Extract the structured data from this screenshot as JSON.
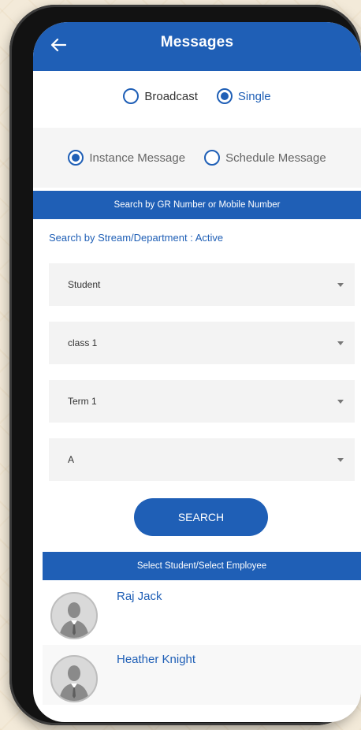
{
  "header": {
    "title": "Messages",
    "back_icon": "arrow-left-icon"
  },
  "recipient_mode": {
    "options": [
      {
        "label": "Broadcast",
        "selected": false
      },
      {
        "label": "Single",
        "selected": true
      }
    ]
  },
  "message_type": {
    "options": [
      {
        "label": "Instance Message",
        "selected": true
      },
      {
        "label": "Schedule Message",
        "selected": false
      }
    ]
  },
  "search_banner": "Search by GR Number or Mobile Number",
  "stream_label": "Search by Stream/Department : Active",
  "dropdowns": [
    {
      "value": "Student"
    },
    {
      "value": "class 1"
    },
    {
      "value": "Term 1"
    },
    {
      "value": "A"
    }
  ],
  "search_button": "SEARCH",
  "select_banner": "Select Student/Select Employee",
  "people": [
    {
      "name": "Raj Jack"
    },
    {
      "name": "Heather Knight"
    }
  ],
  "colors": {
    "primary": "#1f5fb6",
    "background": "#f3ead9"
  }
}
